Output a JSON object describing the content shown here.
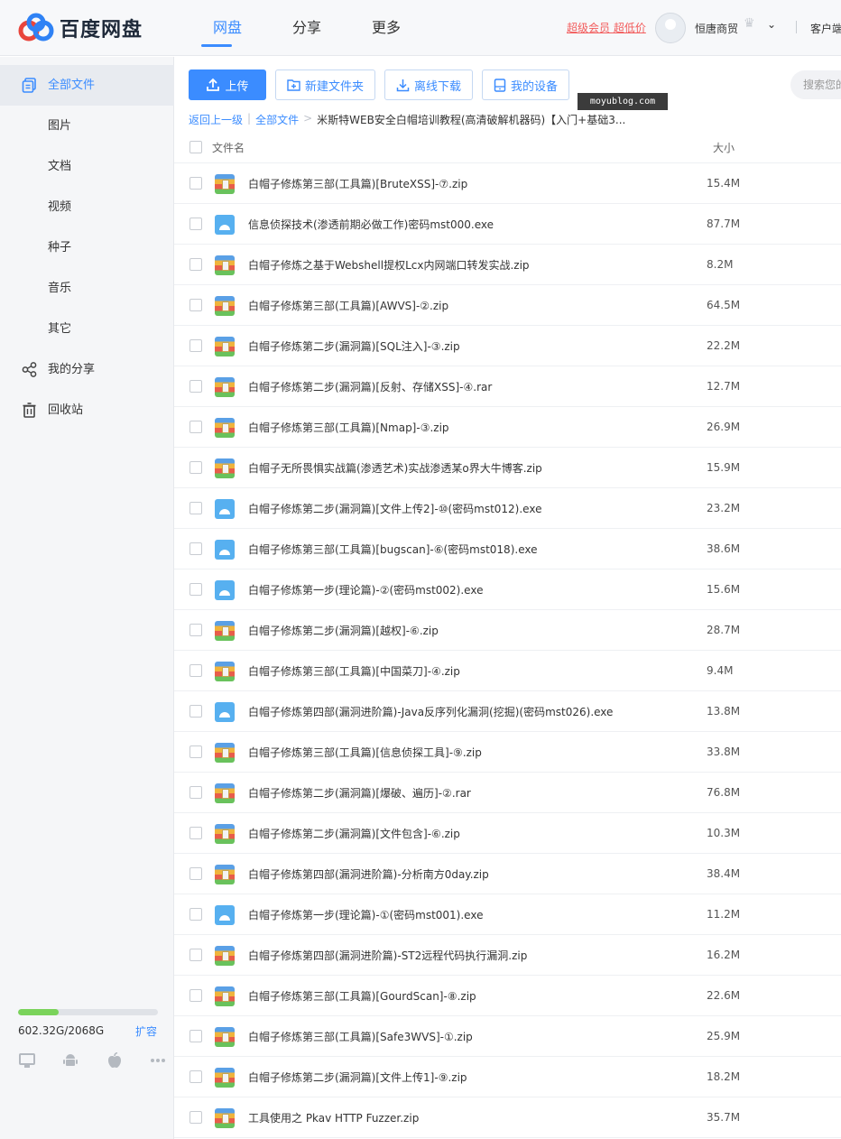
{
  "header": {
    "logo_text": "百度网盘",
    "nav": [
      {
        "label": "网盘",
        "active": true
      },
      {
        "label": "分享",
        "active": false
      },
      {
        "label": "更多",
        "active": false
      }
    ],
    "vip_link": "超级会员 超低价",
    "username": "恒唐商贸",
    "client_label": "客户端"
  },
  "sidebar": {
    "items": [
      {
        "label": "全部文件",
        "icon": "files-icon",
        "active": true
      },
      {
        "label": "图片",
        "icon": "",
        "active": false
      },
      {
        "label": "文档",
        "icon": "",
        "active": false
      },
      {
        "label": "视频",
        "icon": "",
        "active": false
      },
      {
        "label": "种子",
        "icon": "",
        "active": false
      },
      {
        "label": "音乐",
        "icon": "",
        "active": false
      },
      {
        "label": "其它",
        "icon": "",
        "active": false
      },
      {
        "label": "我的分享",
        "icon": "share-icon",
        "active": false
      },
      {
        "label": "回收站",
        "icon": "trash-icon",
        "active": false
      }
    ],
    "quota": {
      "text": "602.32G/2068G",
      "used_fraction": 0.291,
      "expand_label": "扩容"
    },
    "platforms": [
      "desktop-icon",
      "android-icon",
      "apple-icon",
      "more-icon"
    ]
  },
  "toolbar": {
    "upload_label": "上传",
    "new_folder_label": "新建文件夹",
    "offline_download_label": "离线下载",
    "my_devices_label": "我的设备",
    "search_placeholder": "搜索您的",
    "watermark": "moyublog.com"
  },
  "breadcrumb": {
    "back": "返回上一级",
    "root": "全部文件",
    "current": "米斯特WEB安全白帽培训教程(高清破解机器码)【入门+基础3..."
  },
  "list": {
    "col_name": "文件名",
    "col_size": "大小",
    "files": [
      {
        "name": "白帽子修炼第三部(工具篇)[BruteXSS]-⑦.zip",
        "size": "15.4M",
        "type": "zip"
      },
      {
        "name": "信息侦探技术(渗透前期必做工作)密码mst000.exe",
        "size": "87.7M",
        "type": "exe"
      },
      {
        "name": "白帽子修炼之基于Webshell提权Lcx内网端口转发实战.zip",
        "size": "8.2M",
        "type": "zip"
      },
      {
        "name": "白帽子修炼第三部(工具篇)[AWVS]-②.zip",
        "size": "64.5M",
        "type": "zip"
      },
      {
        "name": "白帽子修炼第二步(漏洞篇)[SQL注入]-③.zip",
        "size": "22.2M",
        "type": "zip"
      },
      {
        "name": "白帽子修炼第二步(漏洞篇)[反射、存储XSS]-④.rar",
        "size": "12.7M",
        "type": "zip"
      },
      {
        "name": "白帽子修炼第三部(工具篇)[Nmap]-③.zip",
        "size": "26.9M",
        "type": "zip"
      },
      {
        "name": "白帽子无所畏惧实战篇(渗透艺术)实战渗透某o界大牛博客.zip",
        "size": "15.9M",
        "type": "zip"
      },
      {
        "name": "白帽子修炼第二步(漏洞篇)[文件上传2]-⑩(密码mst012).exe",
        "size": "23.2M",
        "type": "exe"
      },
      {
        "name": "白帽子修炼第三部(工具篇)[bugscan]-⑥(密码mst018).exe",
        "size": "38.6M",
        "type": "exe"
      },
      {
        "name": "白帽子修炼第一步(理论篇)-②(密码mst002).exe",
        "size": "15.6M",
        "type": "exe"
      },
      {
        "name": "白帽子修炼第二步(漏洞篇)[越权]-⑥.zip",
        "size": "28.7M",
        "type": "zip"
      },
      {
        "name": "白帽子修炼第三部(工具篇)[中国菜刀]-④.zip",
        "size": "9.4M",
        "type": "zip"
      },
      {
        "name": "白帽子修炼第四部(漏洞进阶篇)-Java反序列化漏洞(挖掘)(密码mst026).exe",
        "size": "13.8M",
        "type": "exe"
      },
      {
        "name": "白帽子修炼第三部(工具篇)[信息侦探工具]-⑨.zip",
        "size": "33.8M",
        "type": "zip"
      },
      {
        "name": "白帽子修炼第二步(漏洞篇)[爆破、遍历]-②.rar",
        "size": "76.8M",
        "type": "zip"
      },
      {
        "name": "白帽子修炼第二步(漏洞篇)[文件包含]-⑥.zip",
        "size": "10.3M",
        "type": "zip"
      },
      {
        "name": "白帽子修炼第四部(漏洞进阶篇)-分析南方0day.zip",
        "size": "38.4M",
        "type": "zip"
      },
      {
        "name": "白帽子修炼第一步(理论篇)-①(密码mst001).exe",
        "size": "11.2M",
        "type": "exe"
      },
      {
        "name": "白帽子修炼第四部(漏洞进阶篇)-ST2远程代码执行漏洞.zip",
        "size": "16.2M",
        "type": "zip"
      },
      {
        "name": "白帽子修炼第三部(工具篇)[GourdScan]-⑧.zip",
        "size": "22.6M",
        "type": "zip"
      },
      {
        "name": "白帽子修炼第三部(工具篇)[Safe3WVS]-①.zip",
        "size": "25.9M",
        "type": "zip"
      },
      {
        "name": "白帽子修炼第二步(漏洞篇)[文件上传1]-⑨.zip",
        "size": "18.2M",
        "type": "zip"
      },
      {
        "name": "工具使用之 Pkav HTTP Fuzzer.zip",
        "size": "35.7M",
        "type": "zip"
      }
    ]
  }
}
